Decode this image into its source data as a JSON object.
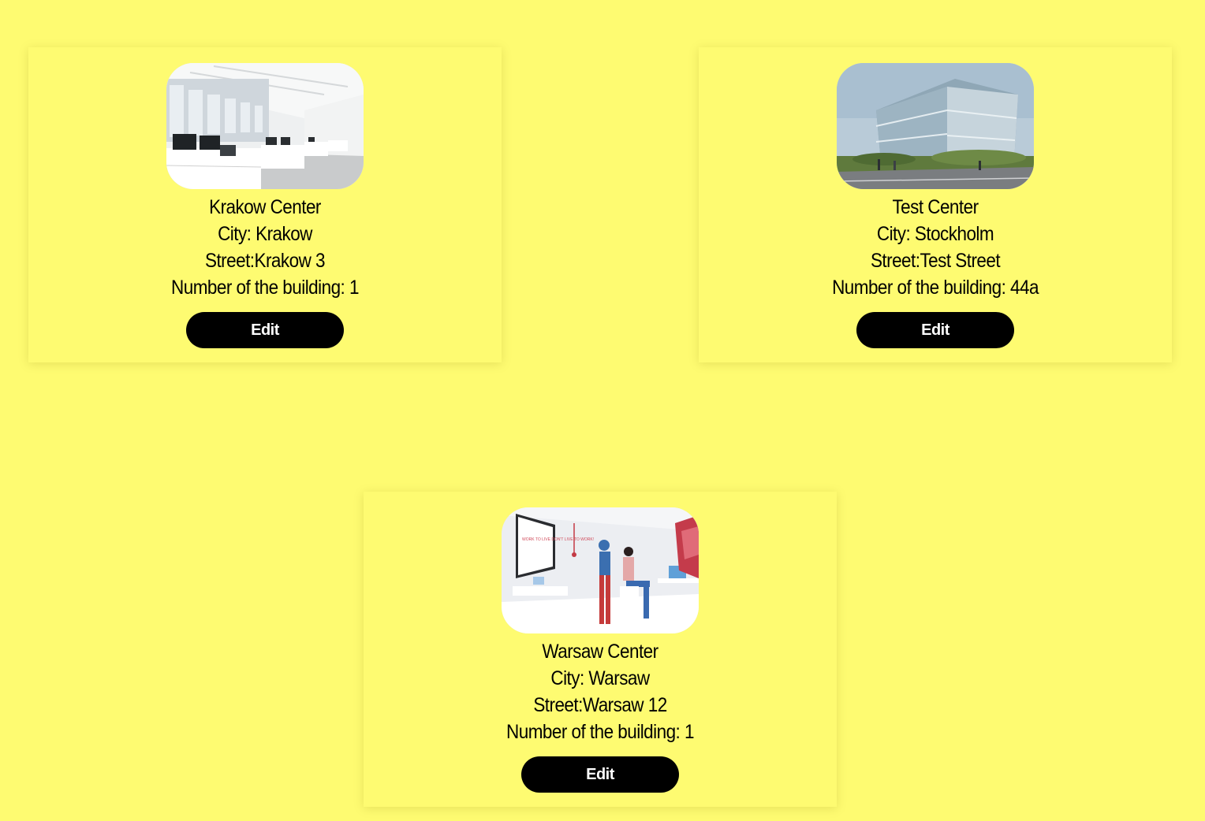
{
  "colors": {
    "background": "#fefb71",
    "card_background": "#fefb71",
    "button_background": "#000000",
    "button_text": "#ffffff",
    "text": "#000000"
  },
  "centers": [
    {
      "name": "Krakow Center",
      "city": "City: Krakow",
      "street": "Street:Krakow 3",
      "building": "Number of the building: 1",
      "edit_label": "Edit",
      "image_icon": "office-interior-photo"
    },
    {
      "name": "Test Center",
      "city": "City: Stockholm",
      "street": "Street:Test Street",
      "building": "Number of the building: 44a",
      "edit_label": "Edit",
      "image_icon": "glass-building-photo"
    },
    {
      "name": "Warsaw Center",
      "city": "City: Warsaw",
      "street": "Street:Warsaw 12",
      "building": "Number of the building: 1",
      "edit_label": "Edit",
      "image_icon": "office-illustration",
      "poster_text": "WORK TO LIVE DON'T LIVE TO WORK!"
    }
  ]
}
